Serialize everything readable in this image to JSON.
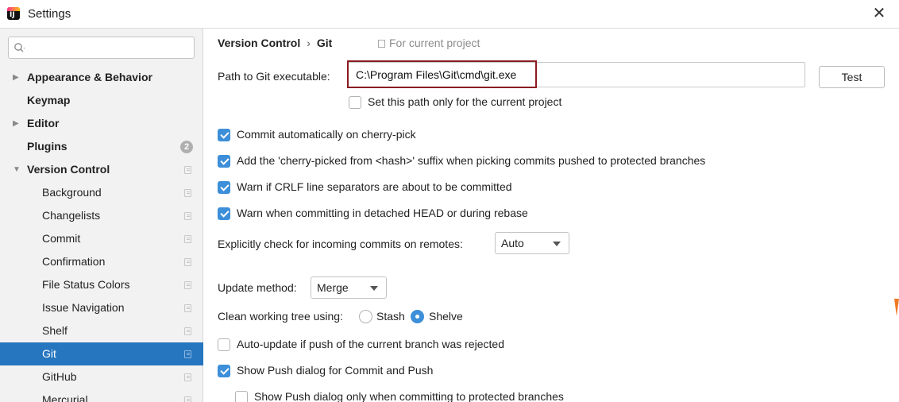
{
  "window": {
    "title": "Settings",
    "close_glyph": "✕"
  },
  "sidebar": {
    "search": {
      "placeholder": "",
      "value": ""
    },
    "items": [
      {
        "label": "Appearance & Behavior",
        "level": 0,
        "bold": true,
        "arrow": "▶"
      },
      {
        "label": "Keymap",
        "level": 0,
        "bold": true
      },
      {
        "label": "Editor",
        "level": 0,
        "bold": true,
        "arrow": "▶"
      },
      {
        "label": "Plugins",
        "level": 0,
        "bold": true,
        "badge": "2"
      },
      {
        "label": "Version Control",
        "level": 0,
        "bold": true,
        "arrow": "▼"
      },
      {
        "label": "Background",
        "level": 1
      },
      {
        "label": "Changelists",
        "level": 1
      },
      {
        "label": "Commit",
        "level": 1
      },
      {
        "label": "Confirmation",
        "level": 1
      },
      {
        "label": "File Status Colors",
        "level": 1
      },
      {
        "label": "Issue Navigation",
        "level": 1
      },
      {
        "label": "Shelf",
        "level": 1
      },
      {
        "label": "Git",
        "level": 1,
        "selected": true
      },
      {
        "label": "GitHub",
        "level": 1
      },
      {
        "label": "Mercurial",
        "level": 1
      }
    ]
  },
  "main": {
    "breadcrumb": {
      "parent": "Version Control",
      "separator": "›",
      "current": "Git"
    },
    "scope_note": "For current project",
    "path": {
      "label": "Path to Git executable:",
      "value": "C:\\Program Files\\Git\\cmd\\git.exe",
      "test_label": "Test",
      "only_current_label": "Set this path only for the current project",
      "only_current_checked": false
    },
    "options": {
      "cherry_pick": {
        "label": "Commit automatically on cherry-pick",
        "checked": true
      },
      "cherry_suffix": {
        "label": "Add the 'cherry-picked from <hash>' suffix when picking commits pushed to protected branches",
        "checked": true
      },
      "crlf": {
        "label": "Warn if CRLF line separators are about to be committed",
        "checked": true
      },
      "detached": {
        "label": "Warn when committing in detached HEAD or during rebase",
        "checked": true
      }
    },
    "incoming": {
      "label": "Explicitly check for incoming commits on remotes:",
      "value": "Auto"
    },
    "update_method": {
      "label": "Update method:",
      "value": "Merge"
    },
    "clean_tree": {
      "label": "Clean working tree using:",
      "options": [
        "Stash",
        "Shelve"
      ],
      "selected": "Shelve"
    },
    "auto_update": {
      "label": "Auto-update if push of the current branch was rejected",
      "checked": false
    },
    "push_dialog": {
      "label": "Show Push dialog for Commit and Push",
      "checked": true
    },
    "push_protected": {
      "label": "Show Push dialog only when committing to protected branches",
      "checked": false
    }
  },
  "colors": {
    "selection": "#2675bf",
    "checkbox_on": "#3c8fd8",
    "highlight_border": "#8b1b22",
    "sidebar_bg": "#f2f2f2"
  },
  "icons": {
    "app": "intellij-icon",
    "search": "search-icon",
    "folder": "folder-icon",
    "project_scope": "project-scope-icon"
  }
}
